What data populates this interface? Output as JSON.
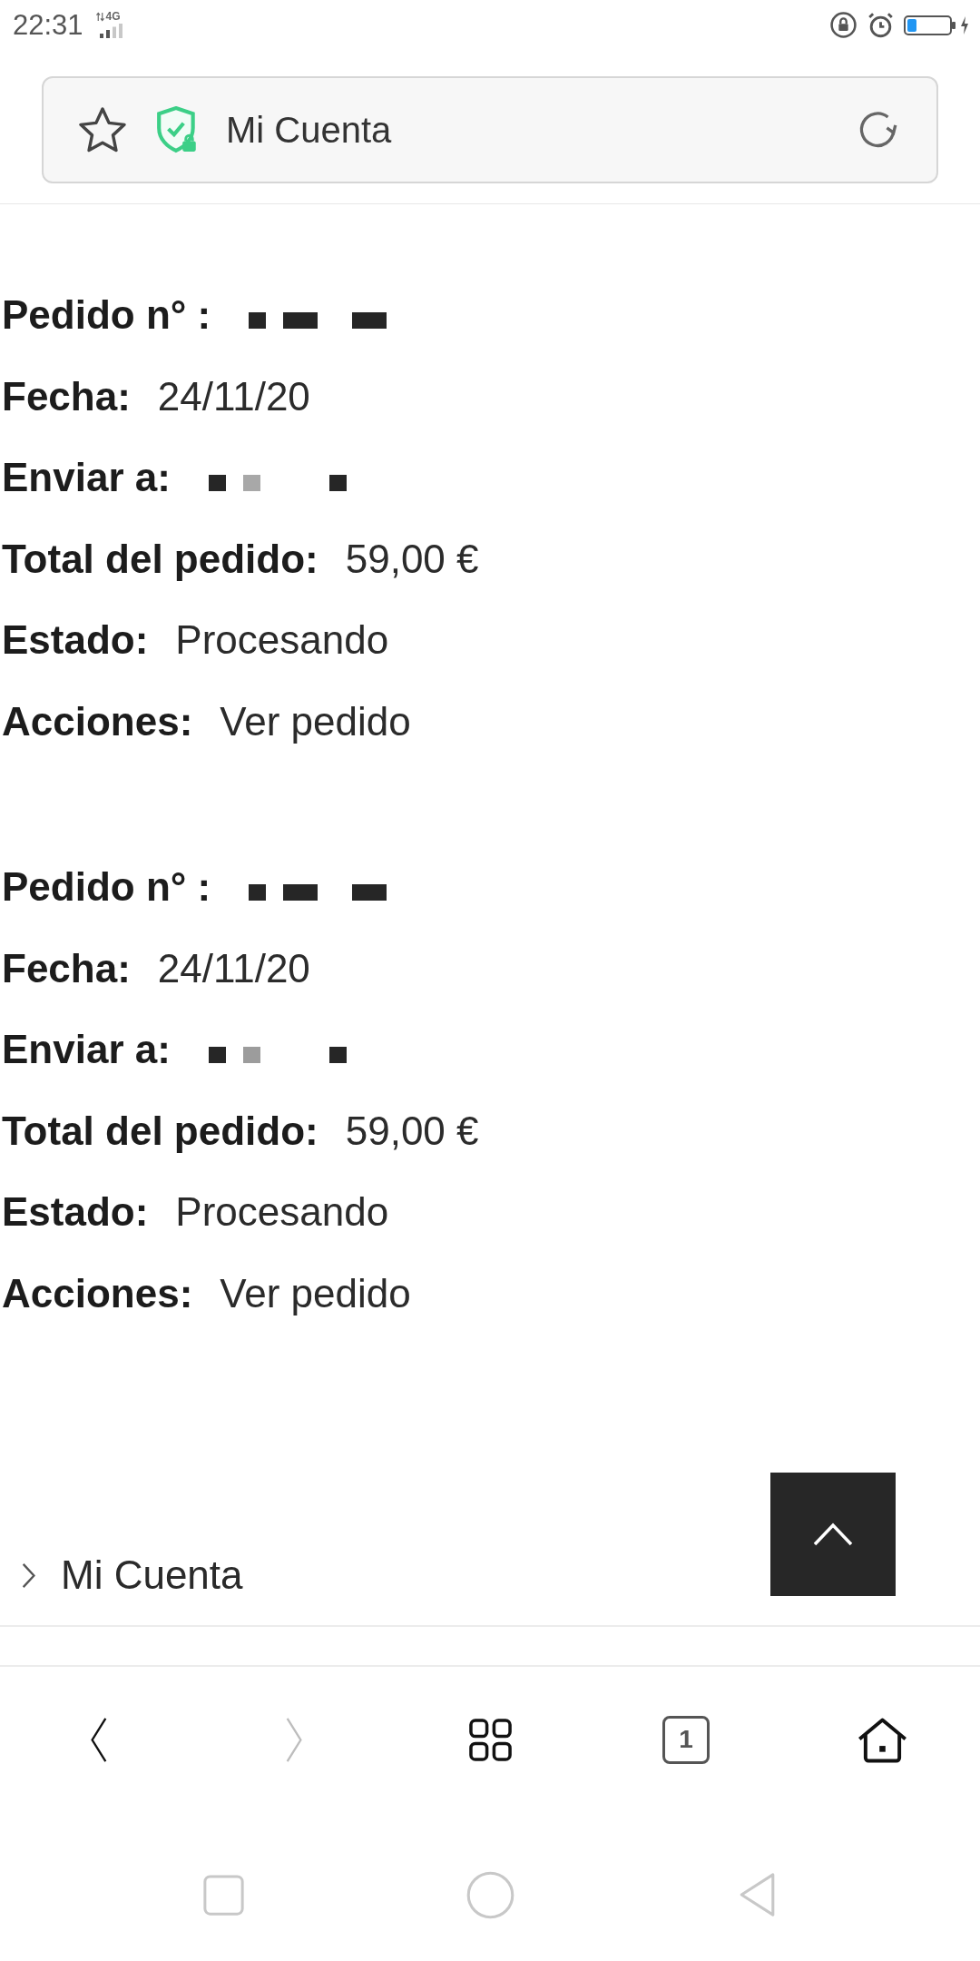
{
  "status_bar": {
    "time": "22:31",
    "network": "4G"
  },
  "address_bar": {
    "title": "Mi Cuenta"
  },
  "orders": [
    {
      "fields": [
        {
          "kind": "redacted",
          "label": "Pedido n° :",
          "cells": [
            {
              "kind": "fill",
              "color": "#262626"
            },
            {
              "kind": "blank"
            },
            {
              "kind": "fill",
              "color": "#262626"
            },
            {
              "kind": "fill",
              "color": "#262626"
            },
            {
              "kind": "blank"
            },
            {
              "kind": "blank"
            },
            {
              "kind": "fill",
              "color": "#262626"
            },
            {
              "kind": "fill",
              "color": "#262626"
            }
          ]
        },
        {
          "kind": "text",
          "label": "Fecha:",
          "value": "24/11/20"
        },
        {
          "kind": "redacted",
          "label": "Enviar a:",
          "cells": [
            {
              "kind": "fill",
              "color": "#262626"
            },
            {
              "kind": "blank"
            },
            {
              "kind": "fill",
              "color": "#a8a8a8"
            },
            {
              "kind": "blank"
            },
            {
              "kind": "blank"
            },
            {
              "kind": "blank"
            },
            {
              "kind": "blank"
            },
            {
              "kind": "fill",
              "color": "#262626"
            }
          ]
        },
        {
          "kind": "text",
          "label": "Total del pedido:",
          "value": "59,00 €"
        },
        {
          "kind": "text",
          "label": "Estado:",
          "value": "Procesando"
        },
        {
          "kind": "link",
          "label": "Acciones:",
          "value": "Ver pedido"
        }
      ]
    },
    {
      "fields": [
        {
          "kind": "redacted",
          "label": "Pedido n° :",
          "cells": [
            {
              "kind": "fill",
              "color": "#262626"
            },
            {
              "kind": "blank"
            },
            {
              "kind": "fill",
              "color": "#262626"
            },
            {
              "kind": "fill",
              "color": "#262626"
            },
            {
              "kind": "blank"
            },
            {
              "kind": "blank"
            },
            {
              "kind": "fill",
              "color": "#262626"
            },
            {
              "kind": "fill",
              "color": "#262626"
            }
          ]
        },
        {
          "kind": "text",
          "label": "Fecha:",
          "value": "24/11/20"
        },
        {
          "kind": "redacted",
          "label": "Enviar a:",
          "cells": [
            {
              "kind": "fill",
              "color": "#262626"
            },
            {
              "kind": "blank"
            },
            {
              "kind": "fill",
              "color": "#9c9c9c"
            },
            {
              "kind": "blank"
            },
            {
              "kind": "blank"
            },
            {
              "kind": "blank"
            },
            {
              "kind": "blank"
            },
            {
              "kind": "fill",
              "color": "#262626"
            }
          ]
        },
        {
          "kind": "text",
          "label": "Total del pedido:",
          "value": "59,00 €"
        },
        {
          "kind": "text",
          "label": "Estado:",
          "value": "Procesando"
        },
        {
          "kind": "link",
          "label": "Acciones:",
          "value": "Ver pedido"
        }
      ]
    }
  ],
  "footer_menu": [
    {
      "label": "Mi Cuenta"
    }
  ],
  "browser_toolbar": {
    "buttons": [
      {
        "kind": "back",
        "disabled": false
      },
      {
        "kind": "forward",
        "disabled": true
      },
      {
        "kind": "menu",
        "disabled": false
      },
      {
        "kind": "tabs",
        "label": "1",
        "disabled": false
      },
      {
        "kind": "home",
        "disabled": false
      }
    ]
  }
}
